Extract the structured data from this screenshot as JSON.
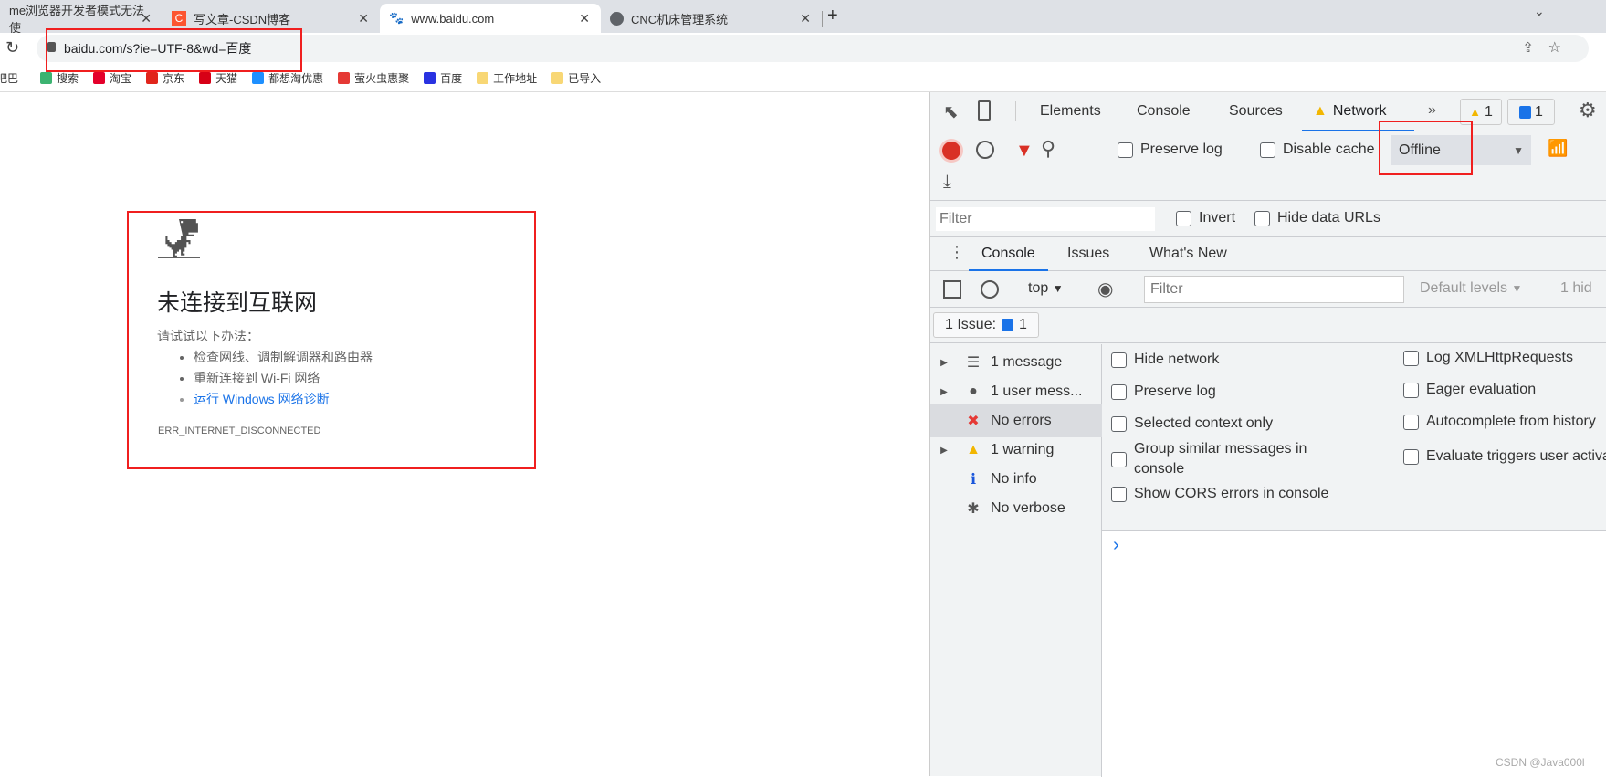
{
  "browser": {
    "tabs": [
      {
        "title": "me浏览器开发者模式无法使",
        "icon": "page-icon"
      },
      {
        "title": "写文章-CSDN博客",
        "icon": "csdn-icon"
      },
      {
        "title": "www.baidu.com",
        "icon": "baidu-paw-icon",
        "active": true
      },
      {
        "title": "CNC机床管理系统",
        "icon": "globe-icon"
      }
    ],
    "url": "baidu.com/s?ie=UTF-8&wd=百度",
    "bookmarks": [
      {
        "label": "吧巴",
        "color": "#999999"
      },
      {
        "label": "搜索",
        "color": "#3cb371"
      },
      {
        "label": "淘宝",
        "color": "#e4002b"
      },
      {
        "label": "京东",
        "color": "#e1251b"
      },
      {
        "label": "天猫",
        "color": "#d70016"
      },
      {
        "label": "都想淘优惠",
        "color": "#1e90ff"
      },
      {
        "label": "萤火虫惠聚",
        "color": "#e53935"
      },
      {
        "label": "百度",
        "color": "#2932e1"
      },
      {
        "label": "工作地址",
        "color": "#f8d775"
      },
      {
        "label": "已导入",
        "color": "#f8d775"
      }
    ]
  },
  "page": {
    "title": "未连接到互联网",
    "try_label": "请试试以下办法：",
    "suggestions": [
      "检查网线、调制解调器和路由器",
      "重新连接到 Wi-Fi 网络"
    ],
    "link": "运行 Windows 网络诊断",
    "error_code": "ERR_INTERNET_DISCONNECTED"
  },
  "devtools": {
    "tabs": [
      "Elements",
      "Console",
      "Sources",
      "Network"
    ],
    "active_tab": "Network",
    "more": "»",
    "warn_count": "1",
    "msg_count": "1",
    "network": {
      "preserve_log": "Preserve log",
      "disable_cache": "Disable cache",
      "throttle": "Offline",
      "filter_placeholder": "Filter",
      "invert": "Invert",
      "hide_data_urls": "Hide data URLs"
    },
    "drawer_tabs": [
      "Console",
      "Issues",
      "What's New"
    ],
    "console": {
      "context": "top",
      "filter_placeholder": "Filter",
      "levels": "Default levels",
      "hidden": "1 hid",
      "issues_label": "1 Issue:",
      "issues_count": "1",
      "sidebar": [
        {
          "label": "1 message",
          "icon": "list-icon",
          "expand": true
        },
        {
          "label": "1 user mess...",
          "icon": "user-icon",
          "expand": true
        },
        {
          "label": "No errors",
          "icon": "error-icon",
          "expand": false,
          "selected": true
        },
        {
          "label": "1 warning",
          "icon": "warning-icon",
          "expand": true
        },
        {
          "label": "No info",
          "icon": "info-icon",
          "expand": false
        },
        {
          "label": "No verbose",
          "icon": "bug-icon",
          "expand": false
        }
      ],
      "settings_left": [
        "Hide network",
        "Preserve log",
        "Selected context only",
        "Group similar messages in console",
        "Show CORS errors in console"
      ],
      "settings_right": [
        "Log XMLHttpRequests",
        "Eager evaluation",
        "Autocomplete from history",
        "Evaluate triggers user activation"
      ],
      "prompt": "›"
    }
  },
  "watermark": "CSDN @Java000l",
  "colors": {
    "accent": "#1a73e8",
    "annotation": "#f01f1f",
    "record": "#d93025"
  }
}
